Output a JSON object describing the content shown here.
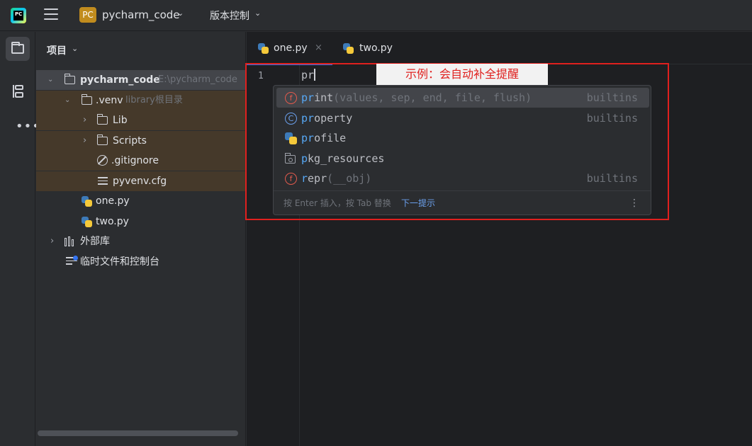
{
  "titlebar": {
    "project_badge": "PC",
    "project_name": "pycharm_code",
    "vcs_label": "版本控制",
    "logo_text": "PC"
  },
  "project_panel": {
    "title": "项目",
    "tree": [
      {
        "label": "pycharm_code",
        "hint": "E:\\pycharm_code",
        "type": "folder",
        "expanded": true
      },
      {
        "label": ".venv",
        "hint": "library根目录",
        "type": "folder",
        "expanded": true
      },
      {
        "label": "Lib",
        "type": "folder",
        "expanded": false
      },
      {
        "label": "Scripts",
        "type": "folder",
        "expanded": false
      },
      {
        "label": ".gitignore",
        "type": "ignore-file"
      },
      {
        "label": "pyvenv.cfg",
        "type": "config-file"
      },
      {
        "label": "one.py",
        "type": "python-file"
      },
      {
        "label": "two.py",
        "type": "python-file"
      },
      {
        "label": "外部库",
        "type": "external-libraries",
        "expanded": false
      },
      {
        "label": "临时文件和控制台",
        "type": "scratches"
      }
    ]
  },
  "editor": {
    "tabs": [
      {
        "label": "one.py",
        "active": true,
        "close": "×"
      },
      {
        "label": "two.py",
        "active": false
      }
    ],
    "line_number": "1",
    "code_typed": "pr"
  },
  "annotation": {
    "text": "示例：会自动补全提醒",
    "color": "#e0201e"
  },
  "completion": {
    "items": [
      {
        "icon": "function-icon",
        "match": "pr",
        "rest": "int",
        "signature": "(values, sep, end, file, flush)",
        "source": "builtins",
        "selected": true
      },
      {
        "icon": "class-icon",
        "match": "pr",
        "rest": "operty",
        "signature": "",
        "source": "builtins",
        "selected": false
      },
      {
        "icon": "python-file-icon",
        "match": "pr",
        "rest": "ofile",
        "signature": "",
        "source": "",
        "selected": false
      },
      {
        "icon": "package-icon",
        "match": "p",
        "rest": "kg_resources",
        "signature": "",
        "source": "",
        "selected": false
      },
      {
        "icon": "function-icon",
        "match": "r",
        "rest": "epr",
        "prefix": "",
        "signature": "(__obj)",
        "source": "builtins",
        "selected": false
      }
    ],
    "footer_hint": "按 Enter 插入，按 Tab 替换",
    "footer_next": "下一提示",
    "kebab": "⋮"
  },
  "colors": {
    "accent": "#3574f0",
    "match_highlight": "#57a8f5",
    "annotation_red": "#e0201e"
  }
}
